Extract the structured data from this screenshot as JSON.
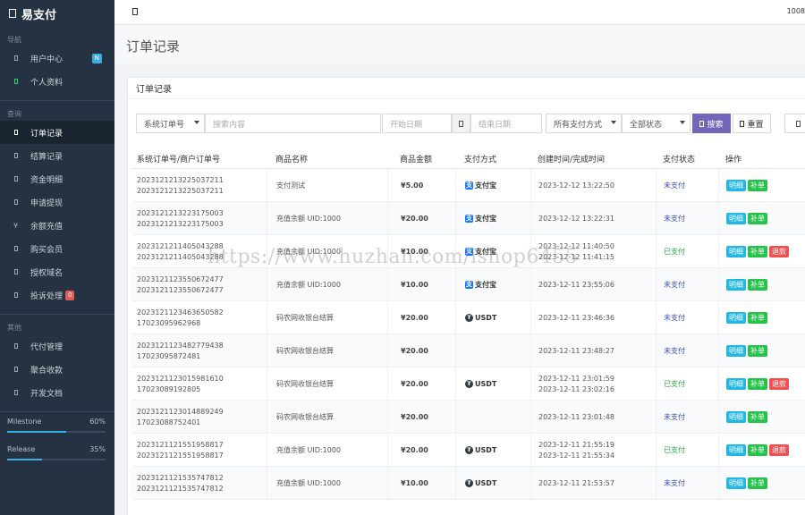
{
  "brand": {
    "name": "易支付"
  },
  "sidebar": {
    "sections": [
      {
        "title": "导航",
        "items": [
          {
            "label": "用户中心",
            "icon": "home-icon",
            "badge": "N"
          },
          {
            "label": "个人资料",
            "icon": "profile-icon",
            "green": true
          }
        ]
      },
      {
        "title": "查询",
        "items": [
          {
            "label": "订单记录",
            "icon": "list-icon",
            "active": true
          },
          {
            "label": "结算记录",
            "icon": "settle-icon"
          },
          {
            "label": "资金明细",
            "icon": "money-icon"
          },
          {
            "label": "申请提现",
            "icon": "withdraw-icon"
          },
          {
            "label": "余额充值",
            "icon": "yen-icon",
            "glyph": "¥"
          },
          {
            "label": "购买会员",
            "icon": "vip-icon"
          },
          {
            "label": "授权域名",
            "icon": "domain-icon"
          },
          {
            "label": "投诉处理",
            "icon": "complaint-icon",
            "badge": "0"
          }
        ]
      },
      {
        "title": "其他",
        "items": [
          {
            "label": "代付管理",
            "icon": "payout-icon"
          },
          {
            "label": "聚合收款",
            "icon": "qrcode-icon"
          },
          {
            "label": "开发文档",
            "icon": "doc-icon"
          }
        ]
      }
    ],
    "progress": [
      {
        "label": "Milestone",
        "value_text": "60%",
        "value": 0.6
      },
      {
        "label": "Release",
        "value_text": "35%",
        "value": 0.35
      }
    ]
  },
  "topbar": {
    "right_text": "1008"
  },
  "page": {
    "title": "订单记录"
  },
  "panel": {
    "title": "订单记录"
  },
  "filters": {
    "search_type": "系统订单号",
    "search_placeholder": "搜索内容",
    "start_placeholder": "开始日期",
    "end_placeholder": "结束日期",
    "pay_type": "所有支付方式",
    "status": "全部状态",
    "search_label": "搜索",
    "reset_label": "重置"
  },
  "table": {
    "columns": [
      "系统订单号/商户订单号",
      "商品名称",
      "商品金额",
      "支付方式",
      "创建时间/完成时间",
      "支付状态",
      "操作"
    ],
    "rows": [
      {
        "trade_no": "2023121213225037211",
        "out_trade_no": "2023121213225037211",
        "name": "支付测试",
        "amount": "¥5.00",
        "pay": "支付宝",
        "pay_type": "alipay",
        "created": "2023-12-12 13:22:50",
        "finished": "",
        "status": "未支付",
        "paid": false,
        "refund": false
      },
      {
        "trade_no": "2023121213223175003",
        "out_trade_no": "2023121213223175003",
        "name": "充值余额 UID:1000",
        "amount": "¥20.00",
        "pay": "支付宝",
        "pay_type": "alipay",
        "created": "2023-12-12 13:22:31",
        "finished": "",
        "status": "未支付",
        "paid": false,
        "refund": false
      },
      {
        "trade_no": "2023121211405043288",
        "out_trade_no": "2023121211405043288",
        "name": "充值余额 UID:1000",
        "amount": "¥10.00",
        "pay": "支付宝",
        "pay_type": "alipay",
        "created": "2023-12-12 11:40:50",
        "finished": "2023-12-12 11:41:15",
        "status": "已支付",
        "paid": true,
        "refund": true
      },
      {
        "trade_no": "2023121123550672477",
        "out_trade_no": "2023121123550672477",
        "name": "充值余额 UID:1000",
        "amount": "¥10.00",
        "pay": "支付宝",
        "pay_type": "alipay",
        "created": "2023-12-11 23:55:06",
        "finished": "",
        "status": "未支付",
        "paid": false,
        "refund": false
      },
      {
        "trade_no": "2023121123463650582",
        "out_trade_no": "17023095962968",
        "name": "码农网收银台结算",
        "amount": "¥20.00",
        "pay": "USDT",
        "pay_type": "usdt",
        "created": "2023-12-11 23:46:36",
        "finished": "",
        "status": "未支付",
        "paid": false,
        "refund": false
      },
      {
        "trade_no": "2023121123482779438",
        "out_trade_no": "17023095872481",
        "name": "码农网收银台结算",
        "amount": "¥20.00",
        "pay": "",
        "pay_type": "",
        "created": "2023-12-11 23:48:27",
        "finished": "",
        "status": "未支付",
        "paid": false,
        "refund": false
      },
      {
        "trade_no": "2023121123015981610",
        "out_trade_no": "17023089192805",
        "name": "码农网收银台结算",
        "amount": "¥20.00",
        "pay": "USDT",
        "pay_type": "usdt",
        "created": "2023-12-11 23:01:59",
        "finished": "2023-12-11 23:02:16",
        "status": "已支付",
        "paid": true,
        "refund": true
      },
      {
        "trade_no": "2023121123014889249",
        "out_trade_no": "17023088752401",
        "name": "码农网收银台结算",
        "amount": "¥20.00",
        "pay": "",
        "pay_type": "",
        "created": "2023-12-11 23:01:48",
        "finished": "",
        "status": "未支付",
        "paid": false,
        "refund": false
      },
      {
        "trade_no": "2023121121551958817",
        "out_trade_no": "2023121121551958817",
        "name": "充值余额 UID:1000",
        "amount": "¥20.00",
        "pay": "USDT",
        "pay_type": "usdt",
        "created": "2023-12-11 21:55:19",
        "finished": "2023-12-11 21:55:34",
        "status": "已支付",
        "paid": true,
        "refund": true
      },
      {
        "trade_no": "2023121121535747812",
        "out_trade_no": "2023121121535747812",
        "name": "充值余额 UID:1000",
        "amount": "¥10.00",
        "pay": "USDT",
        "pay_type": "usdt",
        "created": "2023-12-11 21:53:57",
        "finished": "",
        "status": "未支付",
        "paid": false,
        "refund": false
      }
    ],
    "actions": {
      "detail": "明细",
      "resend": "补单",
      "refund": "退款"
    }
  },
  "watermark": "https://www.huzhan.com/ishop6455",
  "colors": {
    "sidebar_bg": "#243241",
    "search_btn": "#7266ba",
    "info": "#23b7e5",
    "ok": "#27c24c",
    "danger": "#f05050",
    "alipay": "#1677ff"
  }
}
